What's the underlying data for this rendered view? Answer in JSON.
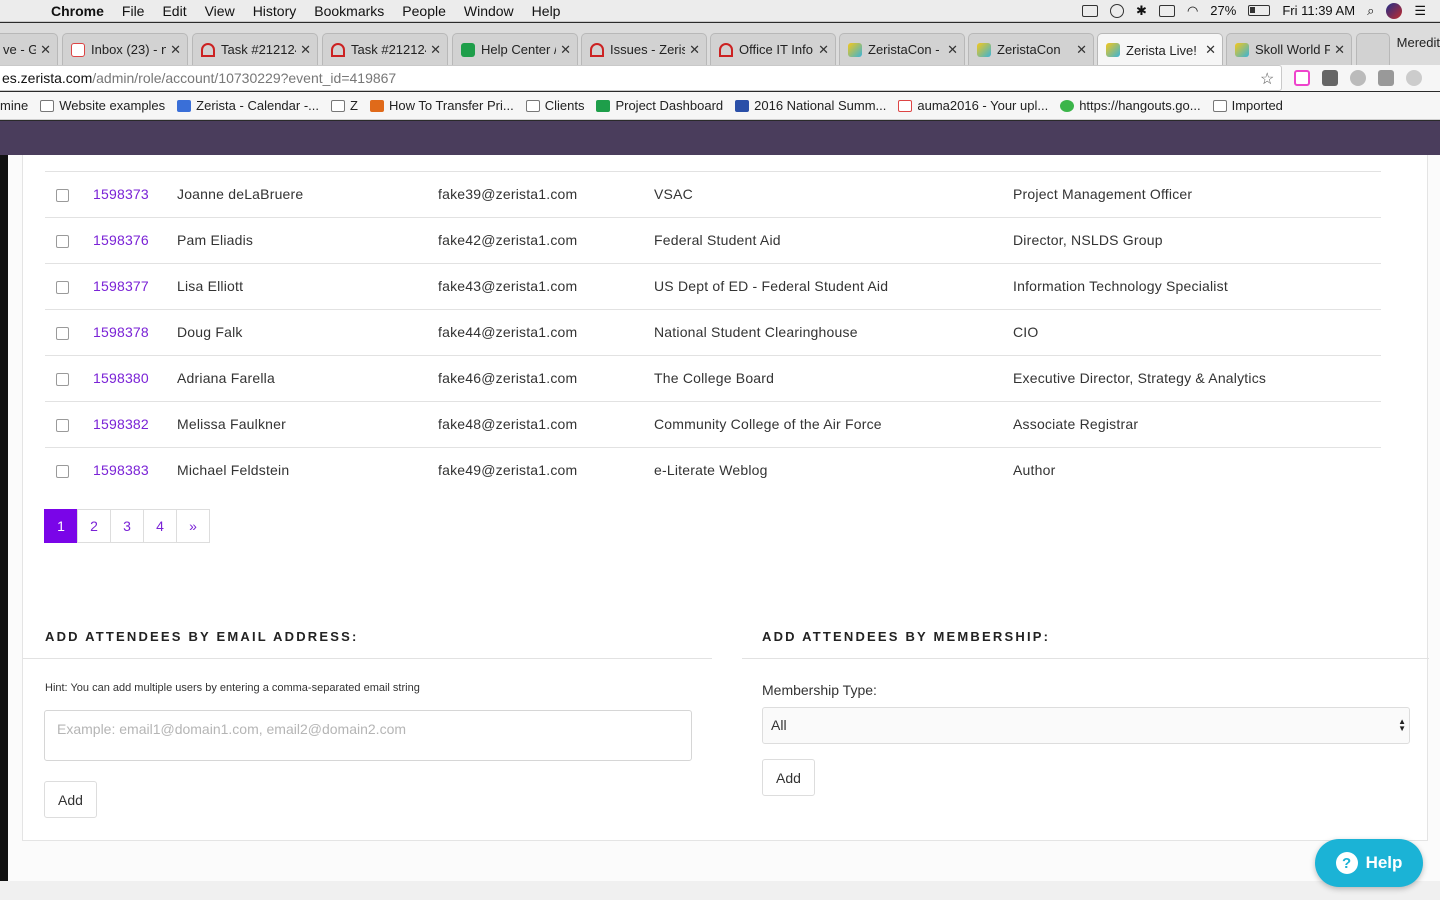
{
  "menubar": {
    "items": [
      "Chrome",
      "File",
      "Edit",
      "View",
      "History",
      "Bookmarks",
      "People",
      "Window",
      "Help"
    ],
    "battery": "27%",
    "clock": "Fri 11:39 AM"
  },
  "tabs": [
    {
      "title": "ve - Go"
    },
    {
      "title": "Inbox (23) - n"
    },
    {
      "title": "Task #212124"
    },
    {
      "title": "Task #212124"
    },
    {
      "title": "Help Center /"
    },
    {
      "title": "Issues - Zeris"
    },
    {
      "title": "Office IT Info"
    },
    {
      "title": "ZeristaCon -"
    },
    {
      "title": "ZeristaCon"
    },
    {
      "title": "Zerista Live!"
    },
    {
      "title": "Skoll World F"
    }
  ],
  "profile_name": "Meredit",
  "address": {
    "host": "es.zerista.com",
    "path": "/admin/role/account/10730229?event_id=419867"
  },
  "bookmarks": [
    "mine",
    "Website examples",
    "Zerista - Calendar -...",
    "Z",
    "How To Transfer Pri...",
    "Clients",
    "Project Dashboard",
    "2016 National Summ...",
    "auma2016 - Your upl...",
    "https://hangouts.go...",
    "Imported"
  ],
  "attendees": [
    {
      "id": "1598373",
      "name": "Joanne deLaBruere",
      "email": "fake39@zerista1.com",
      "org": "VSAC",
      "title": "Project Management Officer"
    },
    {
      "id": "1598376",
      "name": "Pam Eliadis",
      "email": "fake42@zerista1.com",
      "org": "Federal Student Aid",
      "title": "Director, NSLDS Group"
    },
    {
      "id": "1598377",
      "name": "Lisa Elliott",
      "email": "fake43@zerista1.com",
      "org": "US Dept of ED - Federal Student Aid",
      "title": "Information Technology Specialist"
    },
    {
      "id": "1598378",
      "name": "Doug Falk",
      "email": "fake44@zerista1.com",
      "org": "National Student Clearinghouse",
      "title": "CIO"
    },
    {
      "id": "1598380",
      "name": "Adriana Farella",
      "email": "fake46@zerista1.com",
      "org": "The College Board",
      "title": "Executive Director, Strategy & Analytics"
    },
    {
      "id": "1598382",
      "name": "Melissa Faulkner",
      "email": "fake48@zerista1.com",
      "org": "Community College of the Air Force",
      "title": "Associate Registrar"
    },
    {
      "id": "1598383",
      "name": "Michael Feldstein",
      "email": "fake49@zerista1.com",
      "org": "e-Literate Weblog",
      "title": "Author"
    }
  ],
  "pagination": {
    "pages": [
      "1",
      "2",
      "3",
      "4"
    ],
    "next": "»",
    "current": "1"
  },
  "add_by_email": {
    "heading": "ADD ATTENDEES BY EMAIL ADDRESS:",
    "hint": "Hint: You can add multiple users by entering a comma-separated email string",
    "placeholder": "Example: email1@domain1.com, email2@domain2.com",
    "button": "Add"
  },
  "add_by_membership": {
    "heading": "ADD ATTENDEES BY MEMBERSHIP:",
    "label": "Membership Type:",
    "selected": "All",
    "button": "Add"
  },
  "help_button": "Help",
  "colors": {
    "accent": "#7a05e8",
    "link": "#7a22d6",
    "header": "#4a3d5c",
    "help": "#1bb3d6"
  }
}
